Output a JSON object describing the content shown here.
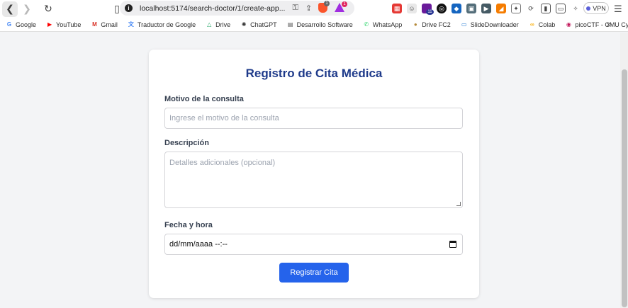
{
  "browser": {
    "url": "localhost:5174/search-doctor/1/create-app...",
    "vpn_label": "VPN",
    "brave_badge": "1",
    "rewards_badge": "1",
    "ext_badge": "11"
  },
  "bookmarks": [
    {
      "label": "Google",
      "icon": "google-icon",
      "color": "#4285f4",
      "glyph": "G"
    },
    {
      "label": "YouTube",
      "icon": "youtube-icon",
      "color": "#ff0000",
      "glyph": "▶"
    },
    {
      "label": "Gmail",
      "icon": "gmail-icon",
      "color": "#d93025",
      "glyph": "M"
    },
    {
      "label": "Traductor de Google",
      "icon": "translate-icon",
      "color": "#4285f4",
      "glyph": "文"
    },
    {
      "label": "Drive",
      "icon": "drive-icon",
      "color": "#1fa463",
      "glyph": "△"
    },
    {
      "label": "ChatGPT",
      "icon": "chatgpt-icon",
      "color": "#333333",
      "glyph": "✺"
    },
    {
      "label": "Desarrollo Software",
      "icon": "folder-doc-icon",
      "color": "#555555",
      "glyph": "▤"
    },
    {
      "label": "WhatsApp",
      "icon": "whatsapp-icon",
      "color": "#25d366",
      "glyph": "✆"
    },
    {
      "label": "Drive FC2",
      "icon": "drive-fc2-icon",
      "color": "#b58a3a",
      "glyph": "●"
    },
    {
      "label": "SlideDownloader",
      "icon": "slidedownloader-icon",
      "color": "#1976d2",
      "glyph": "▭"
    },
    {
      "label": "Colab",
      "icon": "colab-icon",
      "color": "#f9ab00",
      "glyph": "∞"
    },
    {
      "label": "picoCTF - CMU Cyb...",
      "icon": "picoctf-icon",
      "color": "#c2185b",
      "glyph": "◉"
    }
  ],
  "form": {
    "title": "Registro de Cita Médica",
    "reason_label": "Motivo de la consulta",
    "reason_placeholder": "Ingrese el motivo de la consulta",
    "description_label": "Descripción",
    "description_placeholder": "Detalles adicionales (opcional)",
    "datetime_label": "Fecha y hora",
    "datetime_value": "dd/mm/aaaa --:--",
    "submit_label": "Registrar Cita"
  },
  "colors": {
    "title": "#1e3a8a",
    "button": "#2563eb",
    "page_bg": "#f3f4f6"
  }
}
